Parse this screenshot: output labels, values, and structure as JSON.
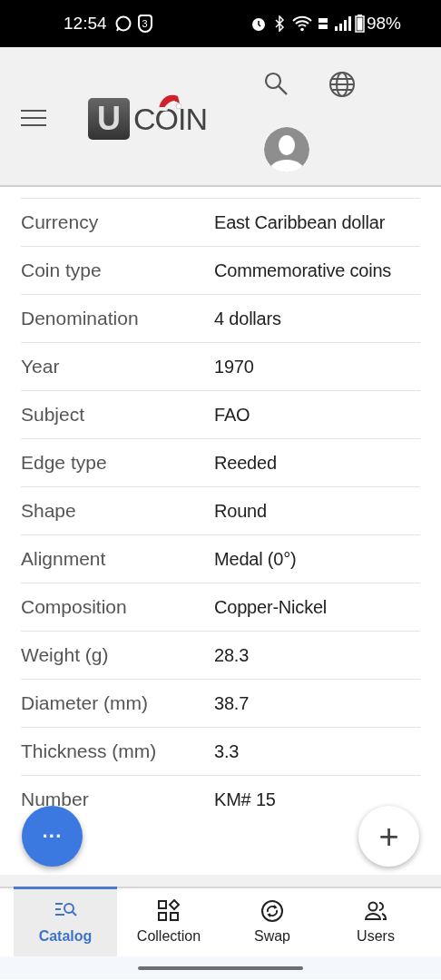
{
  "status_bar": {
    "time": "12:54",
    "notification_count": "3",
    "battery": "98%"
  },
  "header": {
    "logo": {
      "badge": "U",
      "text": "COIN"
    }
  },
  "details": [
    {
      "label": "Currency",
      "value": "East Caribbean dollar"
    },
    {
      "label": "Coin type",
      "value": "Commemorative coins"
    },
    {
      "label": "Denomination",
      "value": "4 dollars"
    },
    {
      "label": "Year",
      "value": "1970"
    },
    {
      "label": "Subject",
      "value": "FAO"
    },
    {
      "label": "Edge type",
      "value": "Reeded"
    },
    {
      "label": "Shape",
      "value": "Round"
    },
    {
      "label": "Alignment",
      "value": "Medal (0°)"
    },
    {
      "label": "Composition",
      "value": "Copper-Nickel"
    },
    {
      "label": "Weight (g)",
      "value": "28.3"
    },
    {
      "label": "Diameter (mm)",
      "value": "38.7"
    },
    {
      "label": "Thickness (mm)",
      "value": "3.3"
    },
    {
      "label": "Number",
      "value": "KM# 15"
    }
  ],
  "fab_more": {
    "label": "···"
  },
  "fab_add": {
    "label": "+"
  },
  "bottom_nav": [
    {
      "kind": "catalog",
      "label": "Catalog",
      "selected": true
    },
    {
      "kind": "collection",
      "label": "Collection",
      "selected": false
    },
    {
      "kind": "swap",
      "label": "Swap",
      "selected": false
    },
    {
      "kind": "users",
      "label": "Users",
      "selected": false
    }
  ]
}
